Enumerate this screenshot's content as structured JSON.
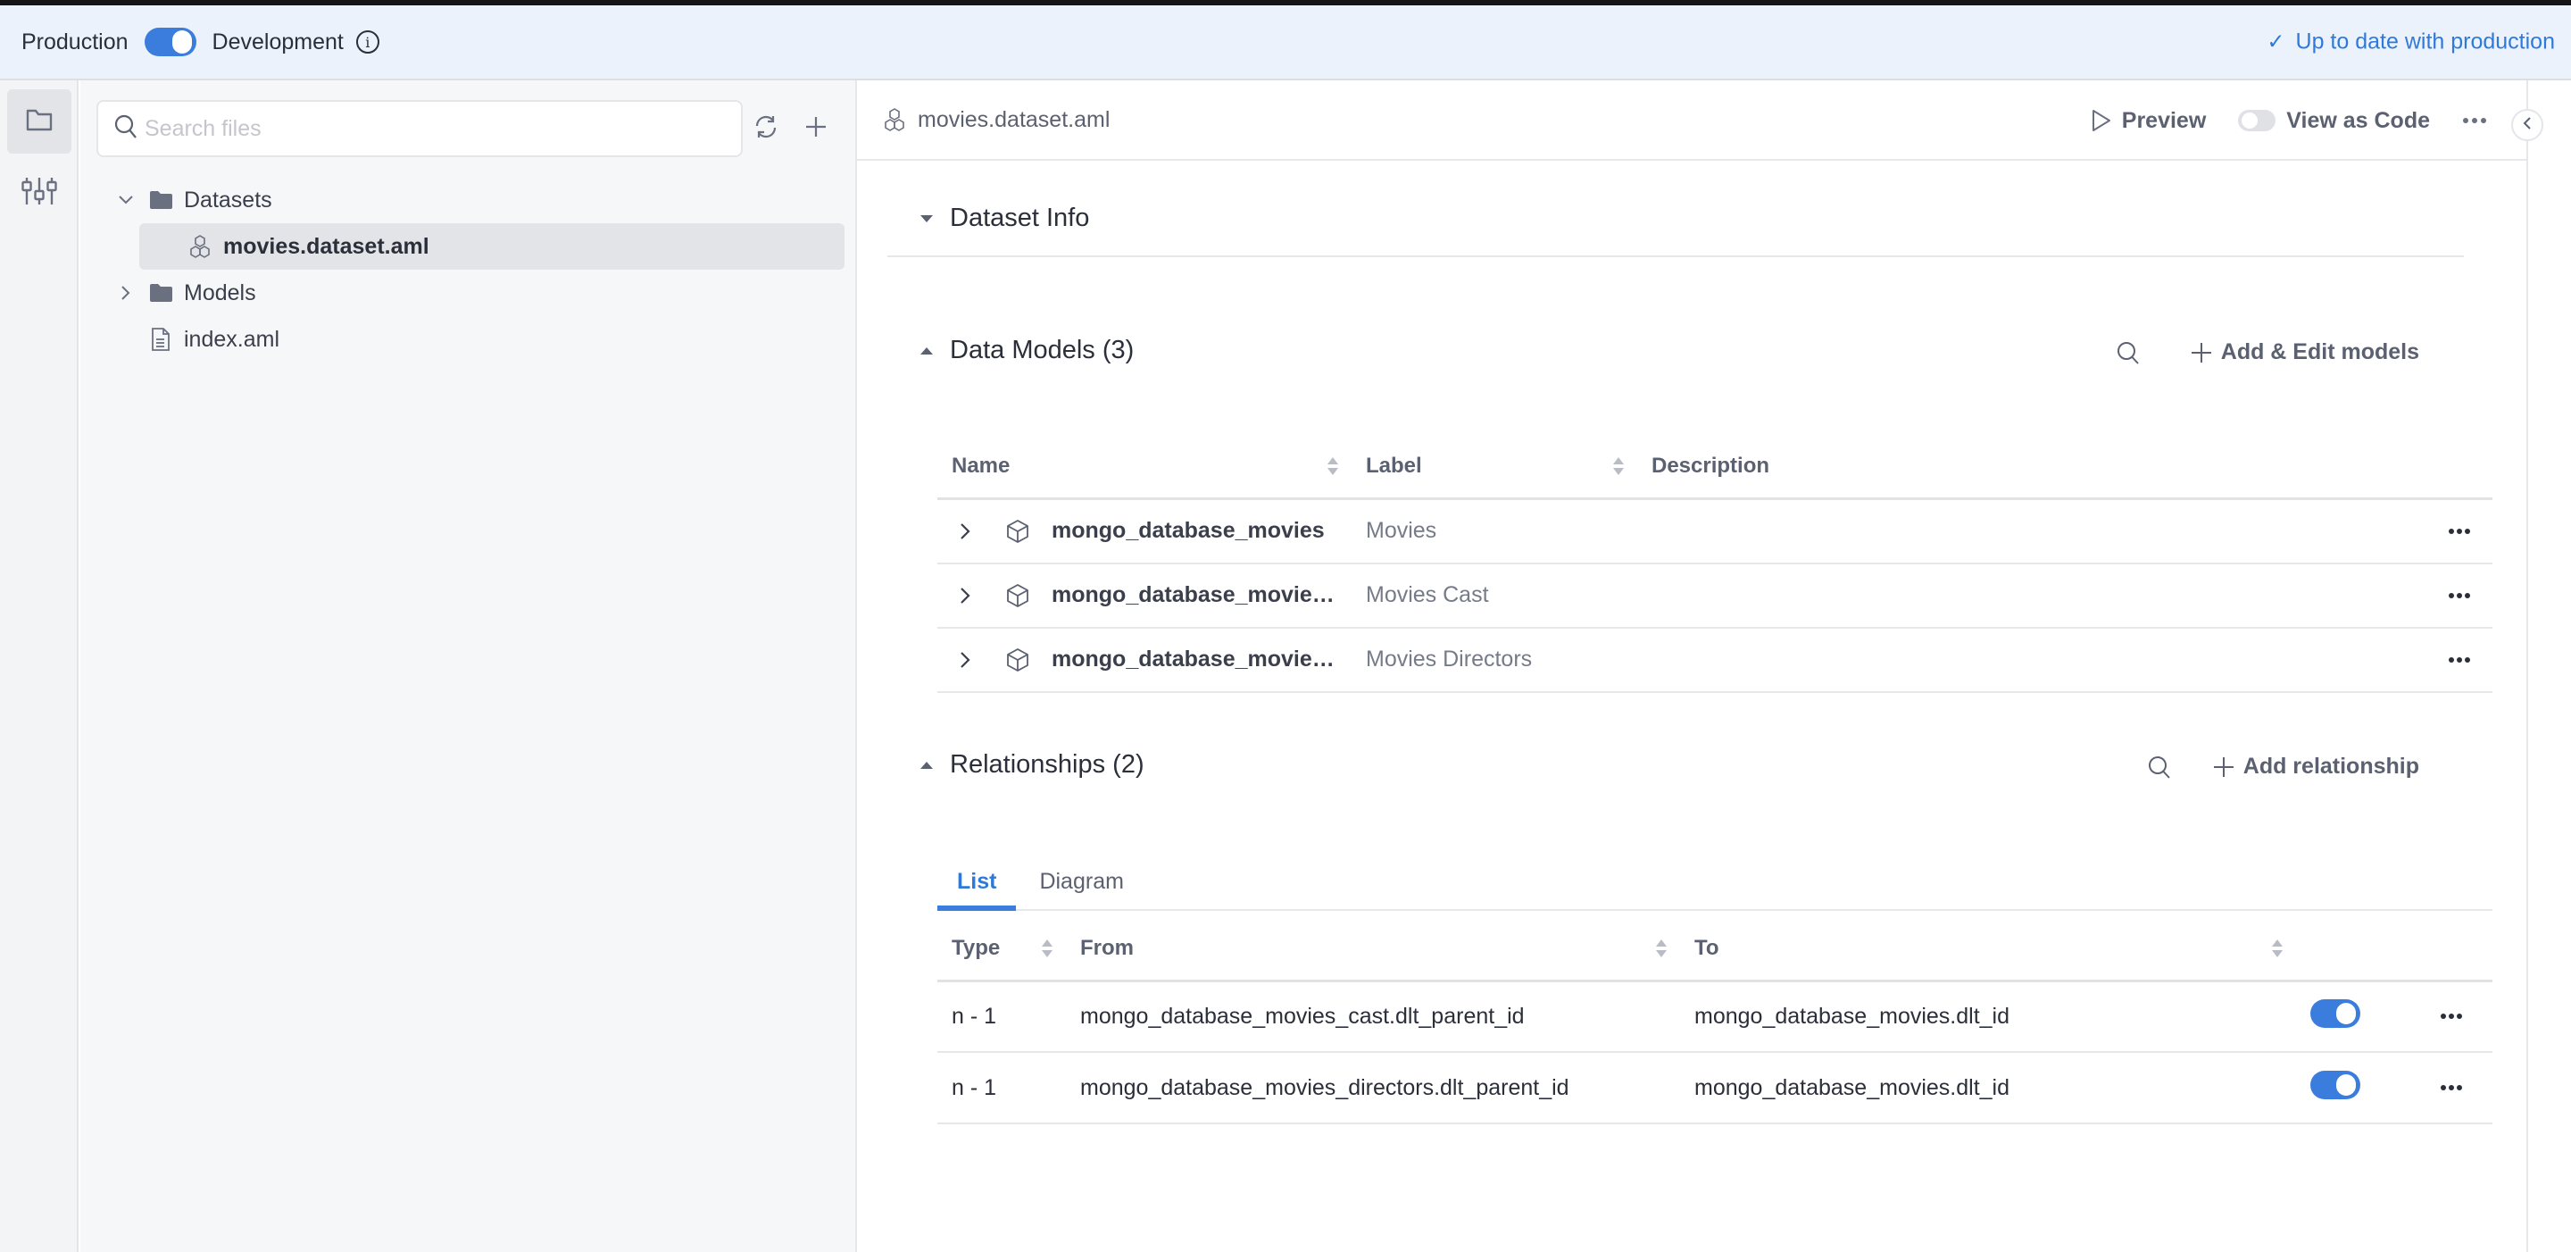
{
  "env": {
    "production_label": "Production",
    "development_label": "Development",
    "mode_toggle_on": true,
    "status_text": "Up to date with production",
    "accent_color": "#3b7ddd"
  },
  "activity_bar": {
    "items": [
      {
        "name": "files",
        "icon": "folder-icon",
        "active": true
      },
      {
        "name": "settings",
        "icon": "sliders-icon",
        "active": false
      }
    ]
  },
  "file_panel": {
    "search_placeholder": "Search files",
    "search_value": "",
    "tree": [
      {
        "label": "Datasets",
        "type": "folder",
        "expanded": true,
        "depth": 0
      },
      {
        "label": "movies.dataset.aml",
        "type": "dataset-file",
        "selected": true,
        "depth": 1
      },
      {
        "label": "Models",
        "type": "folder",
        "expanded": false,
        "depth": 0
      },
      {
        "label": "index.aml",
        "type": "file",
        "depth": 0
      }
    ]
  },
  "editor": {
    "file_name": "movies.dataset.aml",
    "preview_label": "Preview",
    "view_as_code_label": "View as Code",
    "view_as_code_on": false
  },
  "dataset_info": {
    "title": "Dataset Info",
    "collapsed": true
  },
  "data_models": {
    "title": "Data Models (3)",
    "add_label": "Add & Edit models",
    "columns": [
      "Name",
      "Label",
      "Description"
    ],
    "rows": [
      {
        "name": "mongo_database_movies",
        "label": "Movies",
        "description": ""
      },
      {
        "name": "mongo_database_movies...",
        "label": "Movies Cast",
        "description": ""
      },
      {
        "name": "mongo_database_movies...",
        "label": "Movies Directors",
        "description": ""
      }
    ]
  },
  "relationships": {
    "title": "Relationships (2)",
    "add_label": "Add relationship",
    "tabs": [
      {
        "label": "List",
        "active": true
      },
      {
        "label": "Diagram",
        "active": false
      }
    ],
    "columns": [
      "Type",
      "From",
      "To"
    ],
    "rows": [
      {
        "type": "n - 1",
        "from": "mongo_database_movies_cast.dlt_parent_id",
        "to": "mongo_database_movies.dlt_id",
        "enabled": true
      },
      {
        "type": "n - 1",
        "from": "mongo_database_movies_directors.dlt_parent_id",
        "to": "mongo_database_movies.dlt_id",
        "enabled": true
      }
    ]
  }
}
